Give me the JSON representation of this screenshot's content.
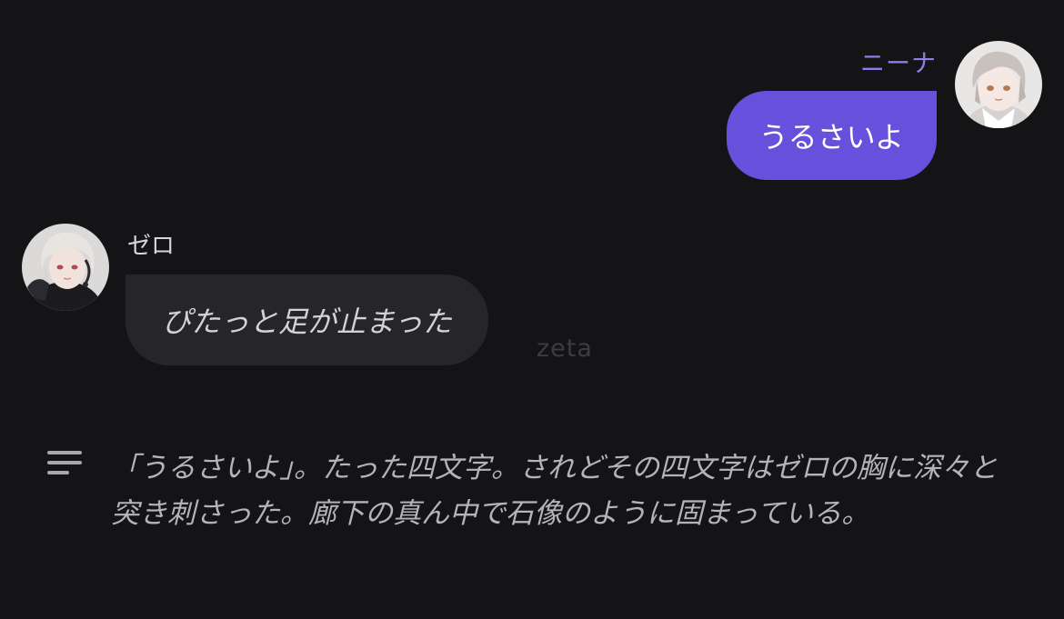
{
  "conversation": {
    "user_message": {
      "sender": "ニーナ",
      "text": "うるさいよ"
    },
    "bot_message": {
      "sender": "ゼロ",
      "text": "ぴたっと足が止まった"
    },
    "watermark": "zeta",
    "narration": {
      "icon": "menu-lines-icon",
      "text": "「うるさいよ」。たった四文字。されどその四文字はゼロの胸に深々と突き刺さった。廊下の真ん中で石像のように固まっている。"
    }
  },
  "colors": {
    "background": "#141316",
    "user_bubble": "#6650dc",
    "bot_bubble": "#26252a",
    "user_name": "#8a7fe6"
  }
}
